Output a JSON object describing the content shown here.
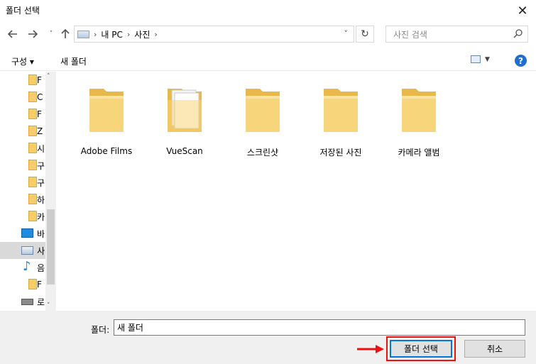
{
  "window": {
    "title": "폴더 선택"
  },
  "nav": {
    "breadcrumb": [
      "내 PC",
      "사진"
    ],
    "search_placeholder": "사진 검색"
  },
  "toolbar": {
    "organize_label": "구성 ▾",
    "new_folder_label": "새 폴더"
  },
  "sidebar": {
    "items": [
      {
        "label": "F"
      },
      {
        "label": "C"
      },
      {
        "label": "F"
      },
      {
        "label": "Z"
      },
      {
        "label": "시"
      },
      {
        "label": "구"
      },
      {
        "label": "구"
      },
      {
        "label": "하"
      },
      {
        "label": "카"
      },
      {
        "label": "바"
      },
      {
        "label": "사"
      },
      {
        "label": "음"
      },
      {
        "label": "F"
      },
      {
        "label": "로"
      }
    ]
  },
  "folders": [
    {
      "name": "Adobe Films"
    },
    {
      "name": "VueScan"
    },
    {
      "name": "스크린샷"
    },
    {
      "name": "저장된 사진"
    },
    {
      "name": "카메라 앨범"
    }
  ],
  "footer": {
    "folder_label": "폴더:",
    "folder_value": "새 폴더",
    "select_button": "폴더 선택",
    "cancel_button": "취소"
  },
  "colors": {
    "accent": "#0078d7",
    "highlight": "#ee1111",
    "folder": "#f5cd6b"
  }
}
